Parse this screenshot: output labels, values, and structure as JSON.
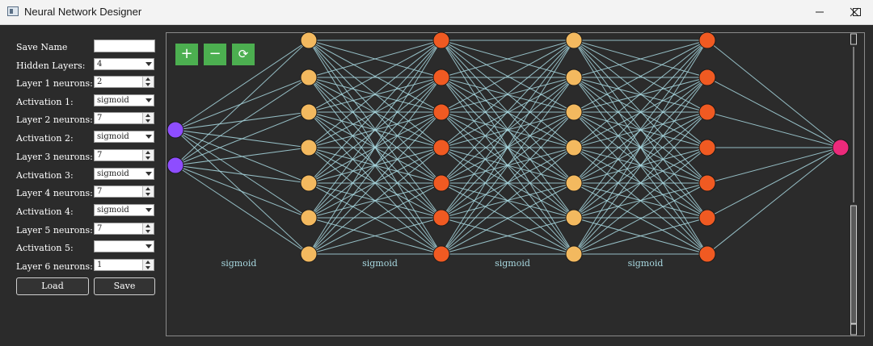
{
  "window": {
    "title": "Neural Network Designer",
    "controls": [
      "minimize-icon",
      "maximize-icon",
      "close-icon"
    ]
  },
  "panel": {
    "save_name": {
      "label": "Save Name",
      "value": ""
    },
    "hidden_layers": {
      "label": "Hidden Layers:",
      "value": "4"
    },
    "rows": [
      {
        "label": "Layer 1 neurons:",
        "value": "2",
        "kind": "spin"
      },
      {
        "label": "Activation 1:",
        "value": "sigmoid",
        "kind": "combo"
      },
      {
        "label": "Layer 2 neurons:",
        "value": "7",
        "kind": "spin"
      },
      {
        "label": "Activation 2:",
        "value": "sigmoid",
        "kind": "combo"
      },
      {
        "label": "Layer 3 neurons:",
        "value": "7",
        "kind": "spin"
      },
      {
        "label": "Activation 3:",
        "value": "sigmoid",
        "kind": "combo"
      },
      {
        "label": "Layer 4 neurons:",
        "value": "7",
        "kind": "spin"
      },
      {
        "label": "Activation 4:",
        "value": "sigmoid",
        "kind": "combo"
      },
      {
        "label": "Layer 5 neurons:",
        "value": "7",
        "kind": "spin"
      },
      {
        "label": "Activation 5:",
        "value": "",
        "kind": "combo"
      },
      {
        "label": "Layer 6 neurons:",
        "value": "1",
        "kind": "spin"
      }
    ],
    "load_label": "Load",
    "save_label": "Save"
  },
  "toolbar": {
    "zoom_in": "+",
    "zoom_out": "−",
    "reset": "⟳"
  },
  "network": {
    "layer_sizes": [
      2,
      7,
      7,
      7,
      7,
      1
    ],
    "activation_labels": [
      "sigmoid",
      "sigmoid",
      "sigmoid",
      "sigmoid"
    ],
    "colors": {
      "input": "#8e4dff",
      "hidden_light": "#f3b95f",
      "hidden_dark": "#f05a22",
      "output": "#ec2a7b",
      "edge": "#a8d8e0",
      "label": "#a8d8e0"
    }
  }
}
